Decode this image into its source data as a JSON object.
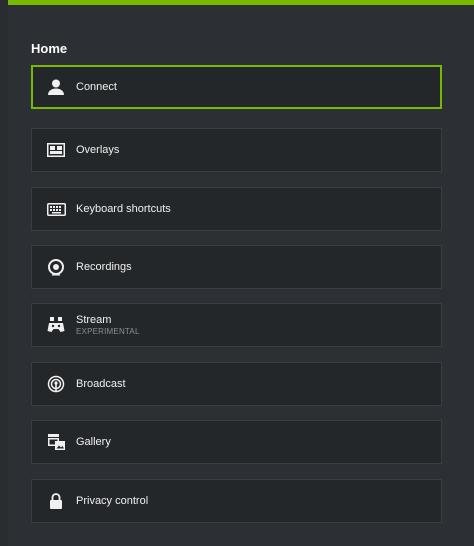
{
  "page": {
    "title": "Home"
  },
  "items": [
    {
      "label": "Connect",
      "sublabel": "",
      "icon": "user-icon",
      "selected": true
    },
    {
      "label": "Overlays",
      "sublabel": "",
      "icon": "overlays-icon",
      "selected": false
    },
    {
      "label": "Keyboard shortcuts",
      "sublabel": "",
      "icon": "keyboard-icon",
      "selected": false
    },
    {
      "label": "Recordings",
      "sublabel": "",
      "icon": "record-icon",
      "selected": false
    },
    {
      "label": "Stream",
      "sublabel": "EXPERIMENTAL",
      "icon": "controller-icon",
      "selected": false
    },
    {
      "label": "Broadcast",
      "sublabel": "",
      "icon": "broadcast-icon",
      "selected": false
    },
    {
      "label": "Gallery",
      "sublabel": "",
      "icon": "gallery-icon",
      "selected": false
    },
    {
      "label": "Privacy control",
      "sublabel": "",
      "icon": "lock-icon",
      "selected": false
    }
  ],
  "colors": {
    "accent": "#76b900",
    "panel": "#2c2f33",
    "item_bg": "#24272a"
  }
}
